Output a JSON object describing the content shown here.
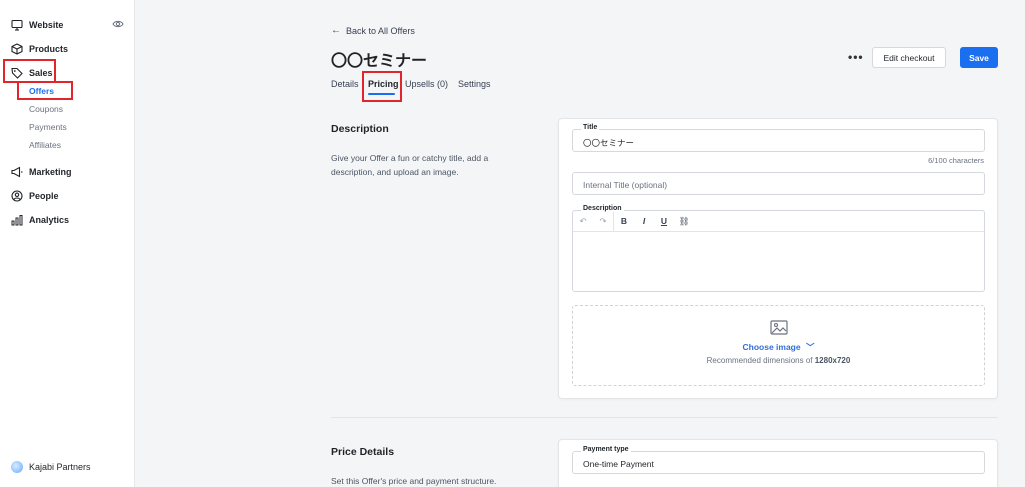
{
  "sidebar": {
    "items": [
      {
        "label": "Website",
        "icon": "monitor-icon"
      },
      {
        "label": "Products",
        "icon": "box-icon"
      },
      {
        "label": "Sales",
        "icon": "tag-icon"
      },
      {
        "label": "Marketing",
        "icon": "megaphone-icon"
      },
      {
        "label": "People",
        "icon": "person-circle-icon"
      },
      {
        "label": "Analytics",
        "icon": "bar-chart-icon"
      }
    ],
    "sales_sub": [
      "Offers",
      "Coupons",
      "Payments",
      "Affiliates"
    ],
    "partners_label": "Kajabi Partners",
    "active_color": "#1f6feb"
  },
  "header": {
    "back_label": "Back to All Offers",
    "title": "〇〇セミナー",
    "more_label": "•••",
    "edit_checkout_label": "Edit checkout",
    "save_label": "Save",
    "save_color": "#1a6ff0"
  },
  "tabs": [
    {
      "label": "Details"
    },
    {
      "label": "Pricing",
      "active": true
    },
    {
      "label": "Upsells (0)"
    },
    {
      "label": "Settings"
    }
  ],
  "description_section": {
    "title": "Description",
    "desc": "Give your Offer a fun or catchy title, add a description, and upload an image.",
    "title_field_label": "Title",
    "title_field_value": "〇〇セミナー",
    "char_count": "6/100 characters",
    "internal_title_placeholder": "Internal Title (optional)",
    "description_label": "Description",
    "toolbar": {
      "undo": "↶",
      "redo": "↷",
      "bold": "B",
      "italic": "I",
      "underline": "U",
      "link": "⛓"
    },
    "choose_image_label": "Choose image",
    "recommended_prefix": "Recommended dimensions of",
    "recommended_size": "1280x720"
  },
  "price_section": {
    "title": "Price Details",
    "desc": "Set this Offer's price and payment structure.",
    "payment_type_label": "Payment type",
    "payment_type_value": "One-time Payment"
  },
  "highlight_color": "#e0262b"
}
